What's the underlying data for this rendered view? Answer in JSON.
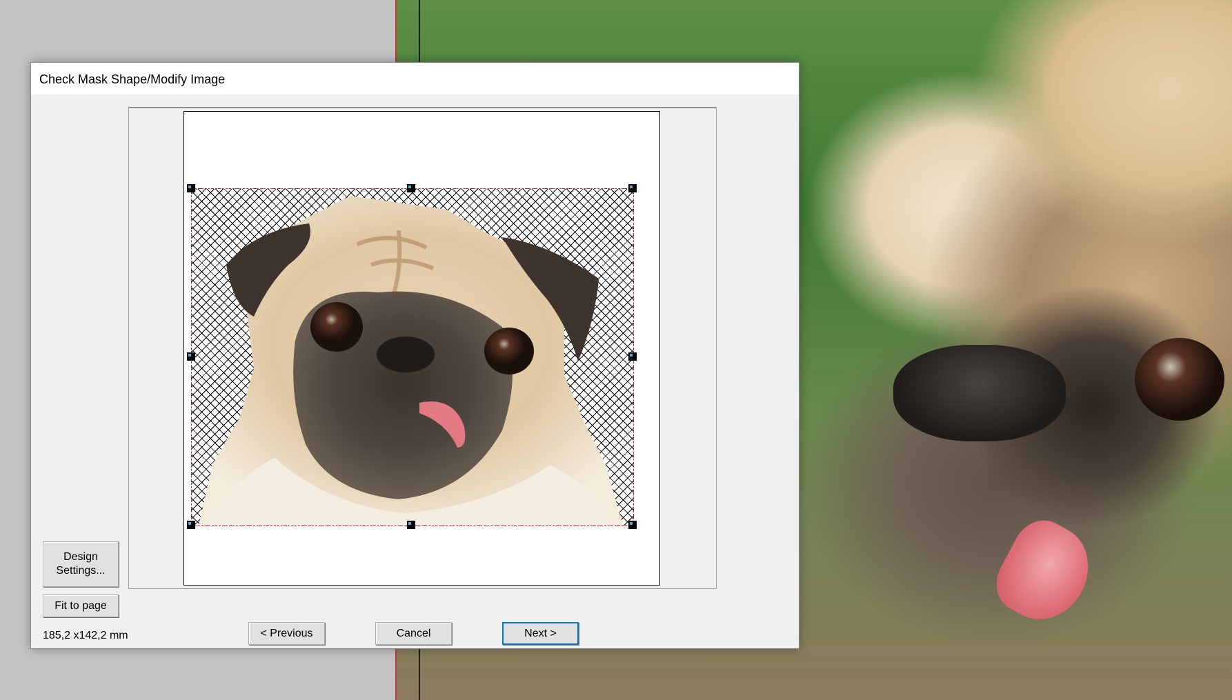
{
  "dialog": {
    "title": "Check Mask Shape/Modify Image",
    "size_readout": "185,2 x142,2 mm",
    "buttons": {
      "design_settings_line1": "Design",
      "design_settings_line2": "Settings...",
      "fit_to_page": "Fit to page",
      "previous": "< Previous",
      "cancel": "Cancel",
      "next": "Next >"
    }
  },
  "colors": {
    "mask_outline": "#d21e28",
    "handle_fill": "#000000",
    "handle_marker": "#47b0d8"
  },
  "icons": {
    "mask_handles": "resize-handle-icon"
  }
}
